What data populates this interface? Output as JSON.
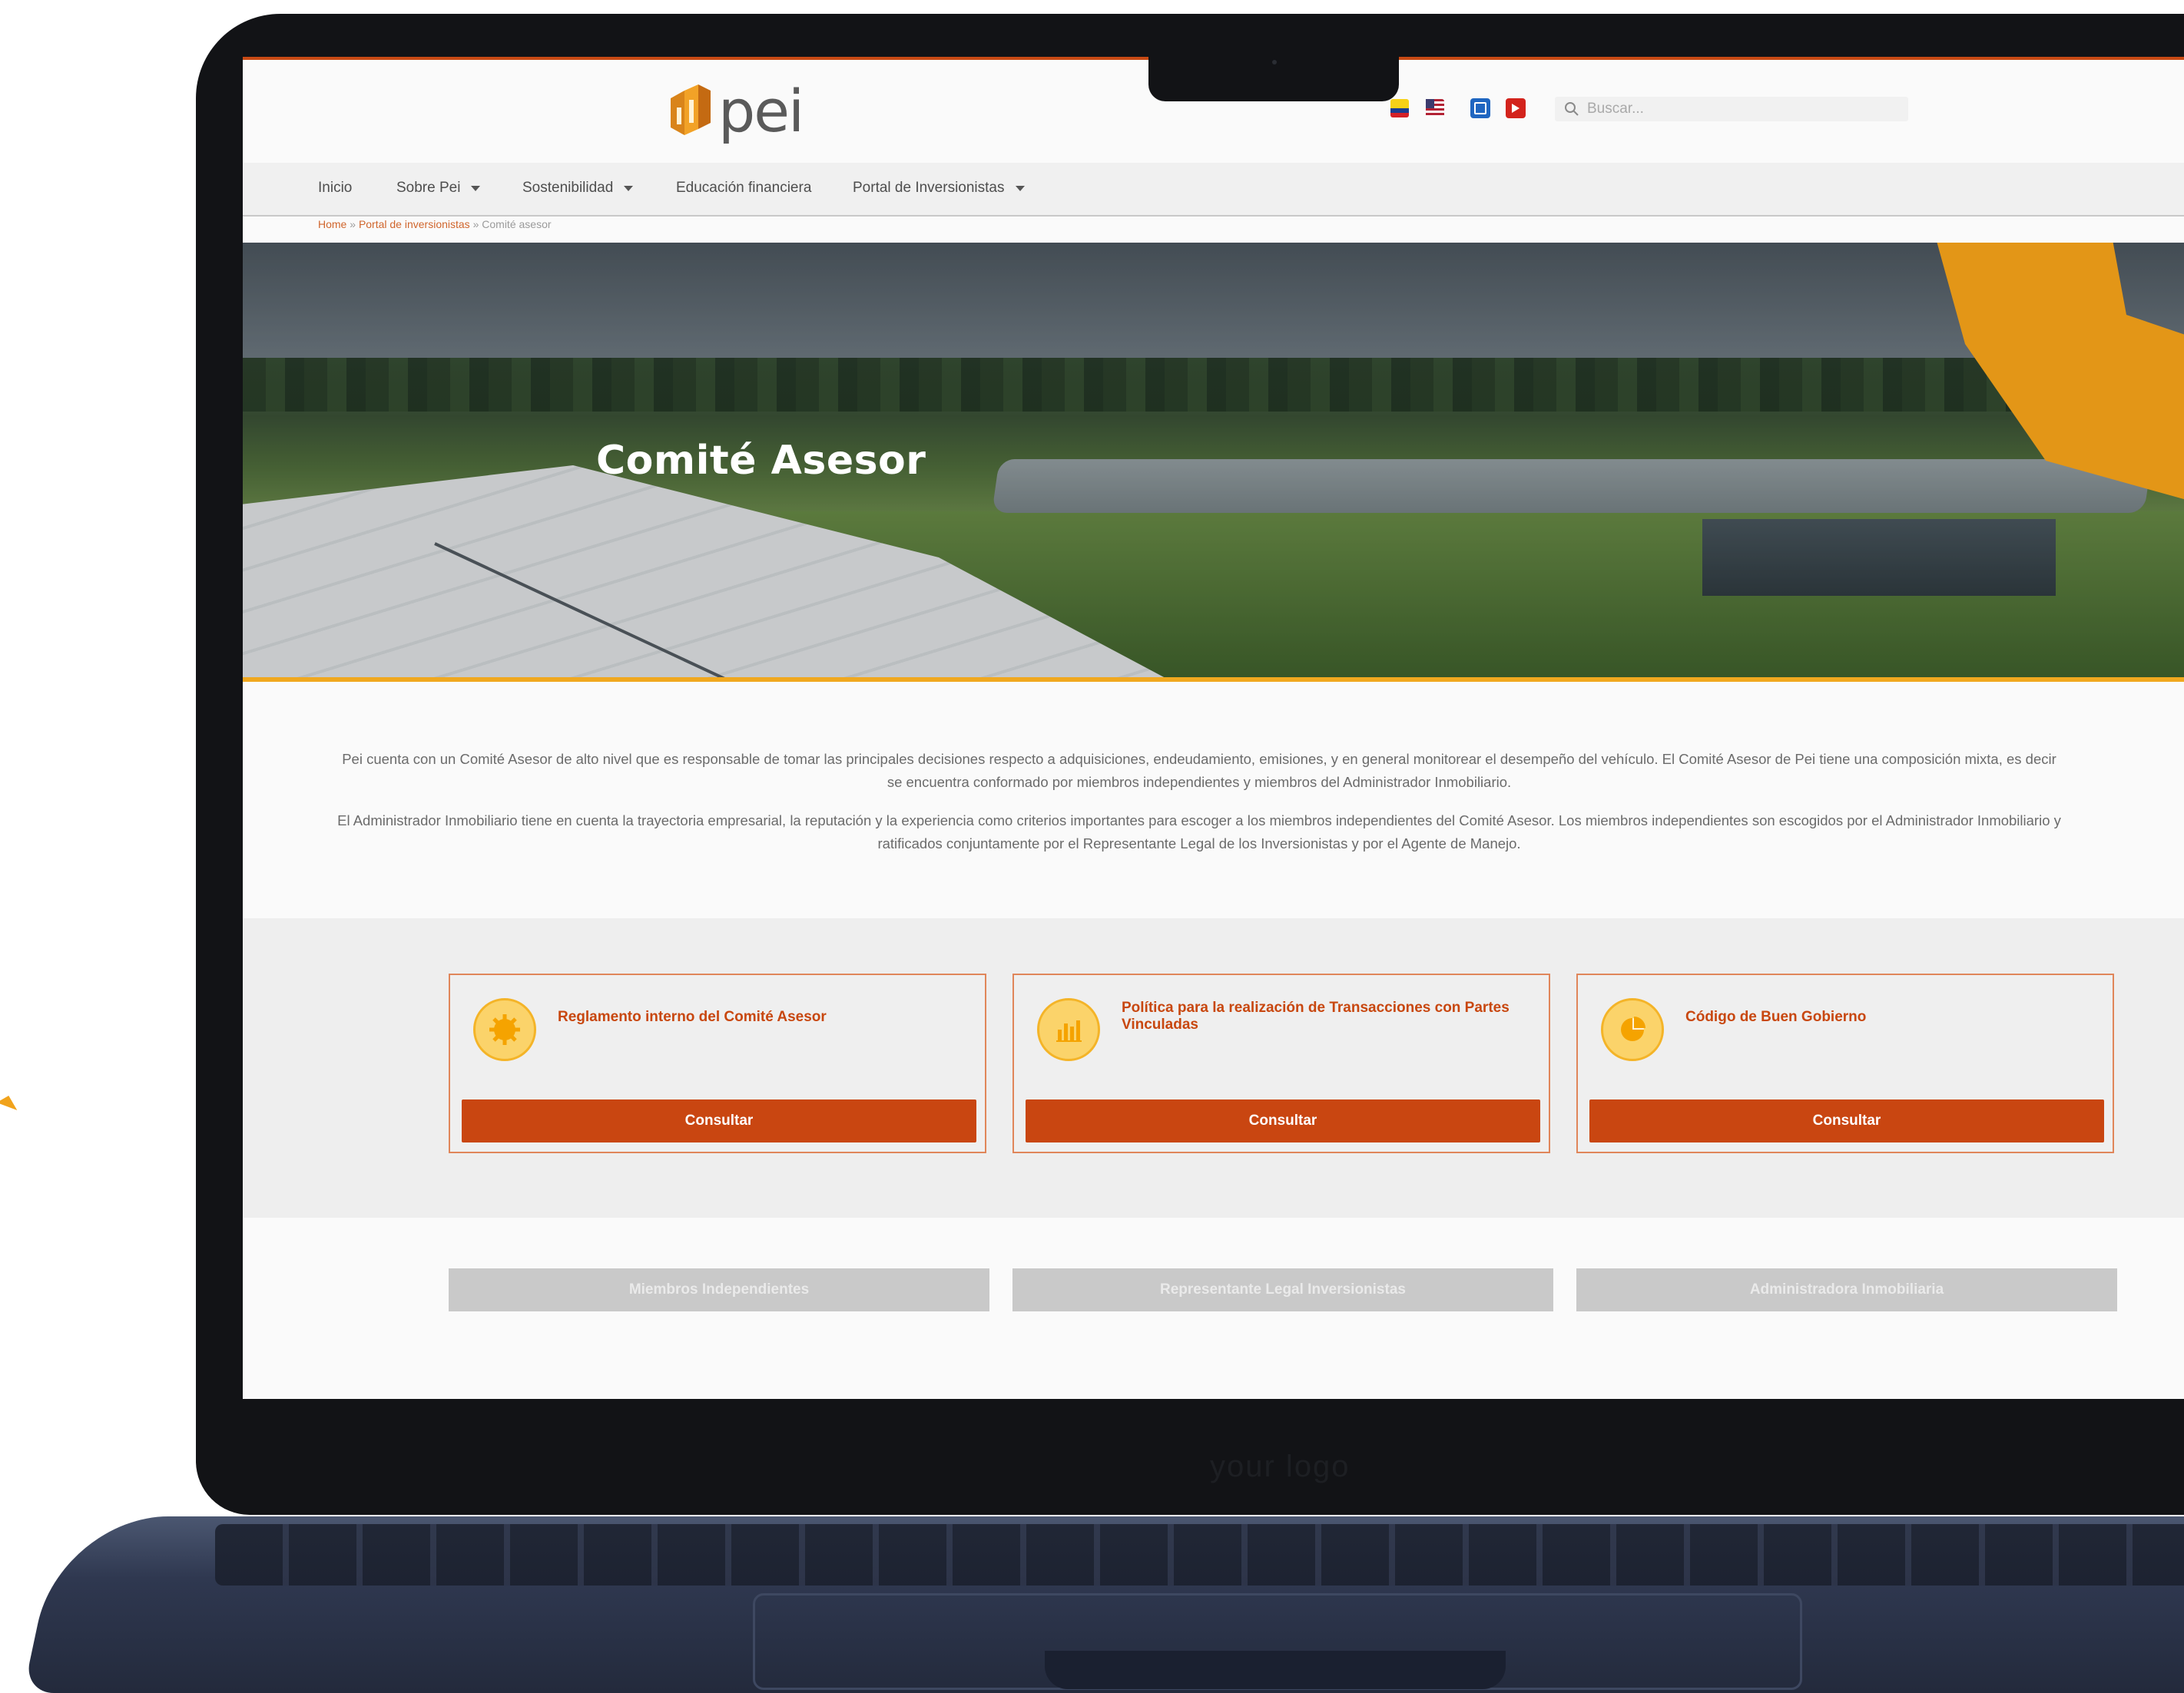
{
  "colors": {
    "accent": "#c94611",
    "accent_title": "#c8470f",
    "yellow": "#f0a81f",
    "tab_grey": "#c9c9c9",
    "text": "#6b6b6b"
  },
  "device": {
    "etched_logo": "your logo"
  },
  "header": {
    "brand": "pei",
    "flags": [
      "colombia-flag-icon",
      "usa-flag-icon"
    ],
    "social": [
      "linkedin-icon",
      "youtube-icon"
    ],
    "search_placeholder": "Buscar..."
  },
  "nav": {
    "items": [
      {
        "label": "Inicio",
        "dropdown": false
      },
      {
        "label": "Sobre Pei",
        "dropdown": true
      },
      {
        "label": "Sostenibilidad",
        "dropdown": true
      },
      {
        "label": "Educación financiera",
        "dropdown": false
      },
      {
        "label": "Portal de Inversionistas",
        "dropdown": true
      }
    ]
  },
  "breadcrumb": {
    "home": "Home",
    "sep": "»",
    "section": "Portal de inversionistas",
    "current": "Comité asesor"
  },
  "hero": {
    "title": "Comité Asesor"
  },
  "intro": {
    "p1": "Pei cuenta con un Comité Asesor de alto nivel que es responsable de tomar las principales decisiones respecto a adquisiciones, endeudamiento, emisiones, y en general monitorear el desempeño del vehículo. El Comité Asesor de Pei tiene una composición mixta, es decir se encuentra conformado por miembros independientes y miembros del Administrador Inmobiliario.",
    "p2": "El Administrador Inmobiliario tiene en cuenta la trayectoria empresarial, la reputación y la experiencia como criterios importantes para escoger a los miembros independientes del Comité Asesor. Los miembros independientes son escogidos por el Administrador Inmobiliario y ratificados conjuntamente por el Representante Legal de los Inversionistas y por el Agente de Manejo."
  },
  "documents": [
    {
      "title": "Reglamento interno del Comité Asesor",
      "icon": "gear-badge-icon",
      "button": "Consultar"
    },
    {
      "title": "Política para la realización de Transacciones con Partes Vinculadas",
      "icon": "bar-chart-icon",
      "button": "Consultar"
    },
    {
      "title": "Código de Buen Gobierno",
      "icon": "pie-chart-icon",
      "button": "Consultar"
    }
  ],
  "tabs": [
    {
      "label": "Miembros Independientes"
    },
    {
      "label": "Representante Legal Inversionistas"
    },
    {
      "label": "Administradora Inmobiliaria"
    }
  ]
}
